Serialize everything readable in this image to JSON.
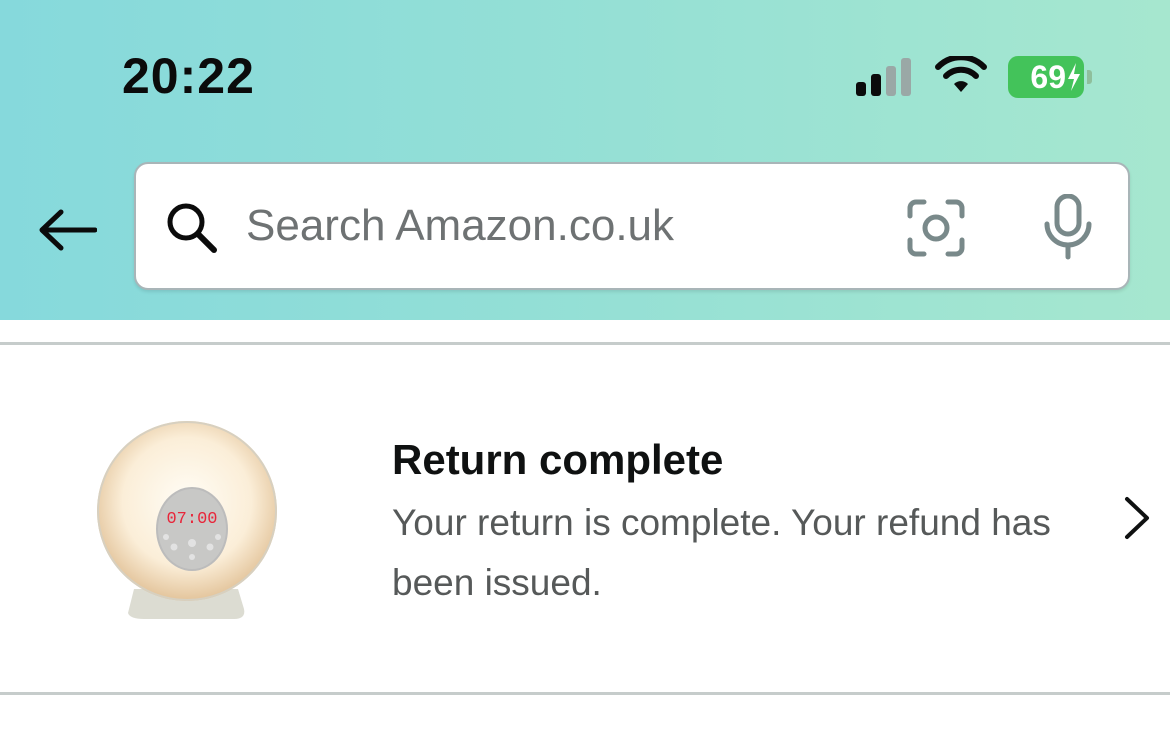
{
  "status_bar": {
    "time": "20:22",
    "battery_percent": "69",
    "signal_bars_active": 2,
    "signal_bars_total": 4,
    "battery_charging": true,
    "battery_color": "#43c35a"
  },
  "header": {
    "back_icon": "arrow-left-icon",
    "search": {
      "placeholder": "Search Amazon.co.uk",
      "value": ""
    },
    "camera_icon": "camera-scan-icon",
    "mic_icon": "microphone-icon",
    "gradient_colors": [
      "#86d9dc",
      "#a6e7cf"
    ]
  },
  "return_item": {
    "title": "Return complete",
    "description": "Your return is complete. Your refund has been issued.",
    "image_clock_text": "07:00",
    "chevron_icon": "chevron-right-icon"
  }
}
